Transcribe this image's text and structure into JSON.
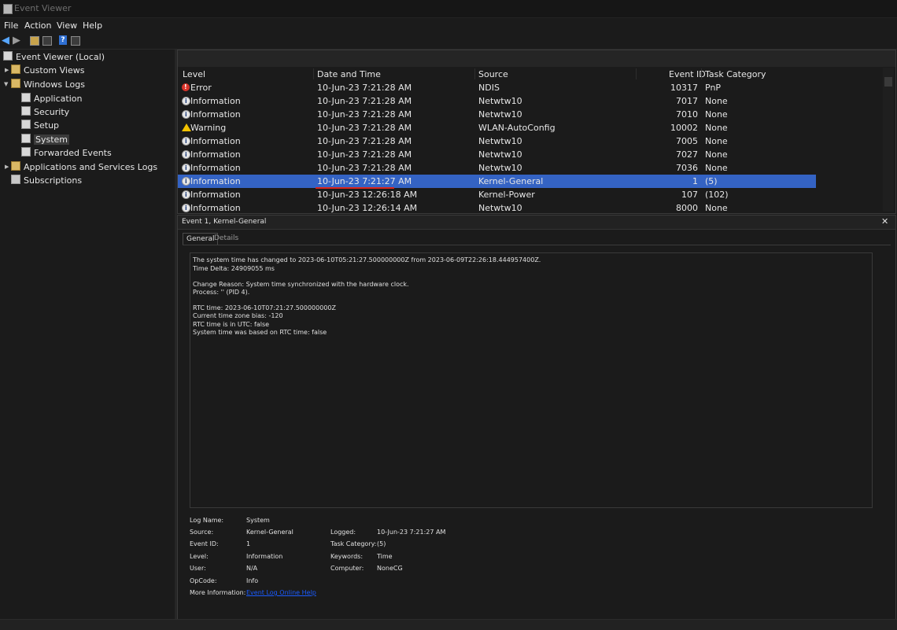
{
  "window": {
    "title": "Event Viewer"
  },
  "menu": [
    "File",
    "Action",
    "View",
    "Help"
  ],
  "toolbar": [
    "back-icon",
    "forward-icon",
    "folder-icon",
    "properties-icon",
    "help-icon",
    "console-icon"
  ],
  "tree": {
    "root": "Event Viewer (Local)",
    "custom_views": "Custom Views",
    "windows_logs": "Windows Logs",
    "application": "Application",
    "security": "Security",
    "setup": "Setup",
    "system": "System",
    "forwarded": "Forwarded Events",
    "apps_services": "Applications and Services Logs",
    "subscriptions": "Subscriptions"
  },
  "list": {
    "columns": {
      "level": "Level",
      "date": "Date and Time",
      "source": "Source",
      "event_id": "Event ID",
      "task": "Task Category"
    },
    "rows": [
      {
        "level": "Error",
        "icon": "error",
        "date": "10-Jun-23 7:21:28 AM",
        "source": "NDIS",
        "event_id": "10317",
        "task": "PnP"
      },
      {
        "level": "Information",
        "icon": "info",
        "date": "10-Jun-23 7:21:28 AM",
        "source": "Netwtw10",
        "event_id": "7017",
        "task": "None"
      },
      {
        "level": "Information",
        "icon": "info",
        "date": "10-Jun-23 7:21:28 AM",
        "source": "Netwtw10",
        "event_id": "7010",
        "task": "None"
      },
      {
        "level": "Warning",
        "icon": "warn",
        "date": "10-Jun-23 7:21:28 AM",
        "source": "WLAN-AutoConfig",
        "event_id": "10002",
        "task": "None"
      },
      {
        "level": "Information",
        "icon": "info",
        "date": "10-Jun-23 7:21:28 AM",
        "source": "Netwtw10",
        "event_id": "7005",
        "task": "None"
      },
      {
        "level": "Information",
        "icon": "info",
        "date": "10-Jun-23 7:21:28 AM",
        "source": "Netwtw10",
        "event_id": "7027",
        "task": "None"
      },
      {
        "level": "Information",
        "icon": "info",
        "date": "10-Jun-23 7:21:28 AM",
        "source": "Netwtw10",
        "event_id": "7036",
        "task": "None"
      },
      {
        "level": "Information",
        "icon": "info",
        "date": "10-Jun-23 7:21:27 AM",
        "source": "Kernel-General",
        "event_id": "1",
        "task": "(5)"
      },
      {
        "level": "Information",
        "icon": "info",
        "date": "10-Jun-23 12:26:18 AM",
        "source": "Kernel-Power",
        "event_id": "107",
        "task": "(102)"
      },
      {
        "level": "Information",
        "icon": "info",
        "date": "10-Jun-23 12:26:14 AM",
        "source": "Netwtw10",
        "event_id": "8000",
        "task": "None"
      }
    ],
    "selected_index": 7
  },
  "detail": {
    "title": "Event 1, Kernel-General",
    "tabs": {
      "general": "General",
      "details": "Details"
    },
    "description": [
      "The system time has changed to 2023-06-10T05:21:27.500000000Z from 2023-06-09T22:26:18.444957400Z.",
      "Time Delta: 24909055 ms",
      "",
      "Change Reason: System time synchronized with the hardware clock.",
      "Process: '' (PID 4).",
      "",
      "RTC time: 2023-06-10T07:21:27.500000000Z",
      "Current time zone bias: -120",
      "RTC time is in UTC: false",
      "System time was based on RTC time: false"
    ],
    "props": {
      "log_name_label": "Log Name:",
      "log_name": "System",
      "source_label": "Source:",
      "source": "Kernel-General",
      "logged_label": "Logged:",
      "logged": "10-Jun-23 7:21:27 AM",
      "event_id_label": "Event ID:",
      "event_id": "1",
      "task_label": "Task Category:",
      "task": "(5)",
      "level_label": "Level:",
      "level": "Information",
      "keywords_label": "Keywords:",
      "keywords": "Time",
      "user_label": "User:",
      "user": "N/A",
      "computer_label": "Computer:",
      "computer": "NoneCG",
      "opcode_label": "OpCode:",
      "opcode": "Info",
      "more_info_label": "More Information:",
      "more_info": "Event Log Online Help"
    }
  }
}
